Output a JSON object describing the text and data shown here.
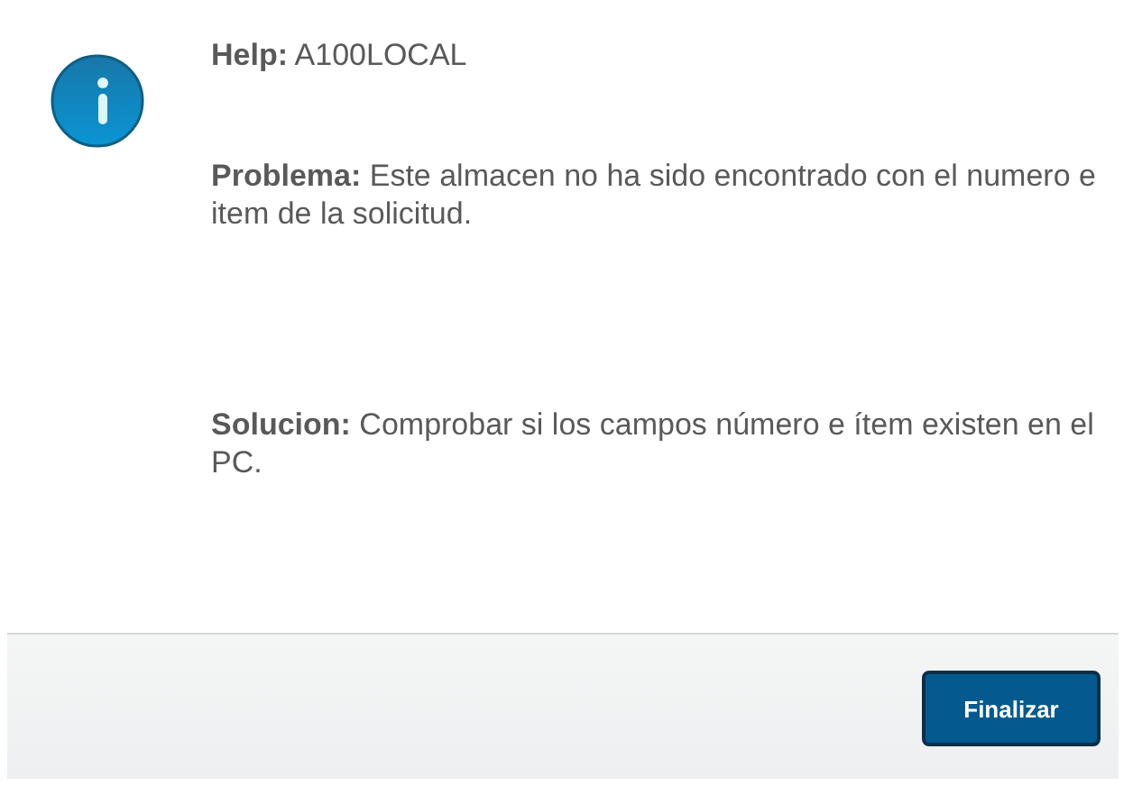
{
  "messages": [
    {
      "text": "**Help:** A100LOCAL"
    },
    {
      "text": "**Problema:** Este almacen no ha sido encontrado con el numero e item de la solicitud."
    },
    {
      "text": "**Solucion:** Comprobar si los campos número e ítem existen en el PC."
    }
  ],
  "buttons": [
    "Finalizar"
  ]
}
